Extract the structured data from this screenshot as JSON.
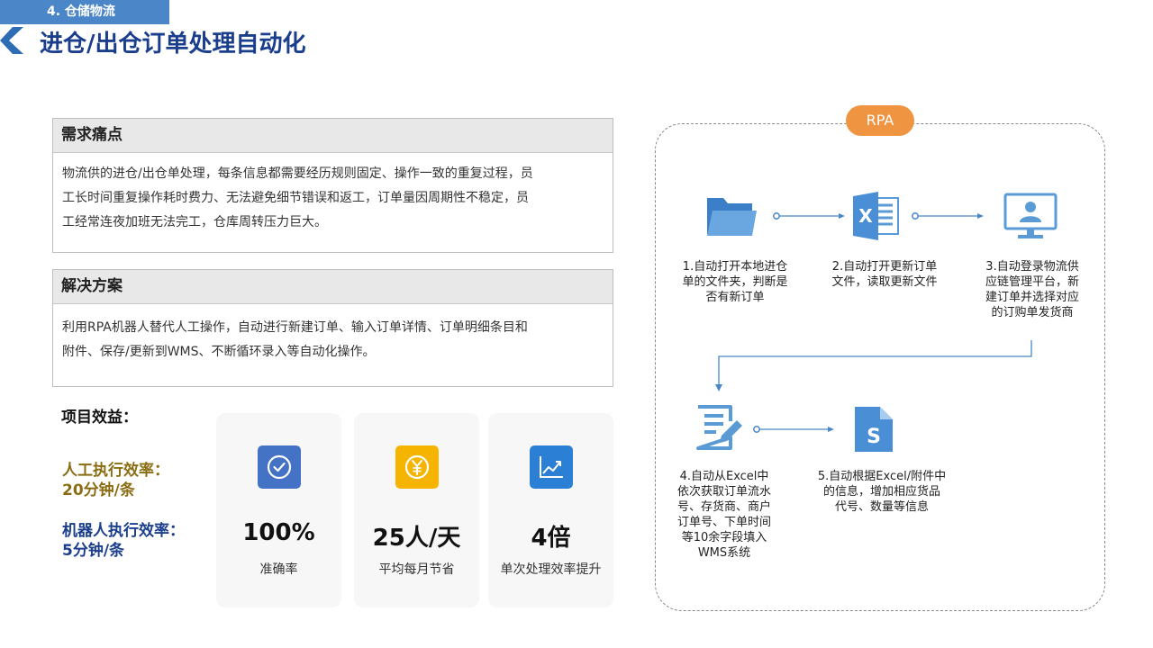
{
  "header": {
    "section_tag": "4. 仓储物流",
    "title": "进仓/出仓订单处理自动化"
  },
  "pain_points": {
    "heading": "需求痛点",
    "lines": [
      "物流供的进仓/出仓单处理，每条信息都需要经历规则固定、操作一致的重复过程，员",
      "工长时间重复操作耗时费力、无法避免细节错误和返工，订单量因周期性不稳定，员",
      "工经常连夜加班无法完工，仓库周转压力巨大。"
    ]
  },
  "solution": {
    "heading": "解决方案",
    "lines": [
      "利用RPA机器人替代人工操作，自动进行新建订单、输入订单详情、订单明细条目和",
      "附件、保存/更新到WMS、不断循环录入等自动化操作。"
    ]
  },
  "benefits": {
    "label": "项目效益：",
    "human_label": "人工执行效率：",
    "human_value": "20分钟/条",
    "robot_label": "机器人执行效率：",
    "robot_value": "5分钟/条",
    "cards": [
      {
        "value": "100%",
        "label": "准确率",
        "icon": "check-circle-icon",
        "color": "#4472c4"
      },
      {
        "value": "25人/天",
        "label": "平均每月节省",
        "icon": "yen-coin-icon",
        "color": "#f4b400"
      },
      {
        "value": "4倍",
        "label": "单次处理效率提升",
        "icon": "trend-chart-icon",
        "color": "#2b7fd4"
      }
    ]
  },
  "flow": {
    "badge": "RPA",
    "steps": [
      {
        "icon": "folder-icon",
        "lines": [
          "1.自动打开本地进仓",
          "单的文件夹，判断是",
          "否有新订单"
        ]
      },
      {
        "icon": "excel-icon",
        "lines": [
          "2.自动打开更新订单",
          "文件，读取更新文件"
        ]
      },
      {
        "icon": "monitor-user-icon",
        "lines": [
          "3.自动登录物流供",
          "应链管理平台，新",
          "建订单并选择对应",
          "的订购单发货商"
        ]
      },
      {
        "icon": "document-edit-icon",
        "lines": [
          "4.自动从Excel中",
          "依次获取订单流水",
          "号、存货商、商户",
          "订单号、下单时间",
          "等10余字段填入",
          "WMS系统"
        ]
      },
      {
        "icon": "s-document-icon",
        "lines": [
          "5.自动根据Excel/附件中",
          "的信息，增加相应货品",
          "代号、数量等信息"
        ]
      }
    ],
    "colors": {
      "icon": "#5b9bd5",
      "arrow": "#4a86c8"
    }
  }
}
